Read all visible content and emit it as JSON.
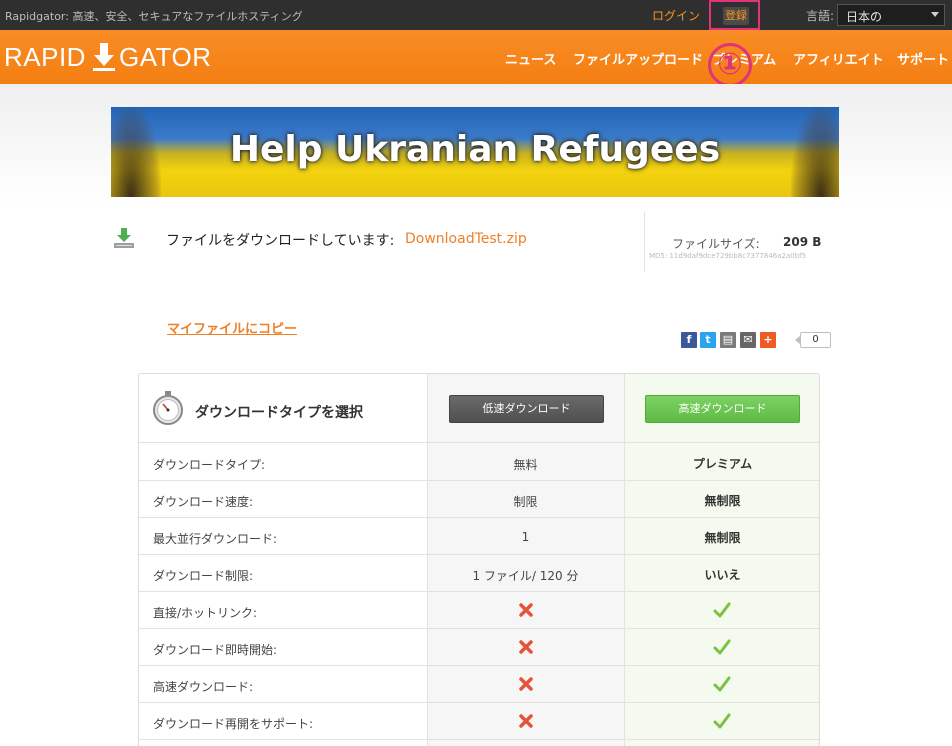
{
  "topbar": {
    "tagline": "Rapidgator: 高速、安全、セキュアなファイルホスティング",
    "login": "ログイン",
    "register": "登録",
    "language_label": "言語:",
    "language_value": "日本の"
  },
  "header": {
    "logo_left": "RAPID",
    "logo_right": "GATOR",
    "nav": [
      "ニュース",
      "ファイルアップロード",
      "プレミアム",
      "アフィリエイト",
      "サポート"
    ]
  },
  "annotation": {
    "marker": "①"
  },
  "banner": {
    "text": "Help Ukranian Refugees"
  },
  "file": {
    "label": "ファイルをダウンロードしています:",
    "name": "DownloadTest.zip",
    "size_label": "ファイルサイズ:",
    "size_value": "209 B",
    "md5": "MD5: 11d9daf9dce729bb8c7377846a2a0bf5"
  },
  "copy_link": "マイファイルにコピー",
  "share": {
    "count": "0",
    "icons": [
      "facebook-icon",
      "twitter-icon",
      "print-icon",
      "email-icon",
      "plus-icon"
    ]
  },
  "compare": {
    "title": "ダウンロードタイプを選択",
    "slow_button": "低速ダウンロード",
    "fast_button": "高速ダウンロード",
    "rows": [
      {
        "label": "ダウンロードタイプ:",
        "free": "無料",
        "premium": "プレミアム"
      },
      {
        "label": "ダウンロード速度:",
        "free": "制限",
        "premium": "無制限"
      },
      {
        "label": "最大並行ダウンロード:",
        "free": "1",
        "premium": "無制限"
      },
      {
        "label": "ダウンロード制限:",
        "free": "1 ファイル/ 120 分",
        "premium": "いいえ"
      },
      {
        "label": "直接/ホットリンク:",
        "free": "no",
        "premium": "yes"
      },
      {
        "label": "ダウンロード即時開始:",
        "free": "no",
        "premium": "yes"
      },
      {
        "label": "高速ダウンロード:",
        "free": "no",
        "premium": "yes"
      },
      {
        "label": "ダウンロード再開をサポート:",
        "free": "no",
        "premium": "yes"
      }
    ]
  },
  "colors": {
    "orange": "#f47e12",
    "highlight": "#e0337a",
    "green": "#5fbb45"
  }
}
